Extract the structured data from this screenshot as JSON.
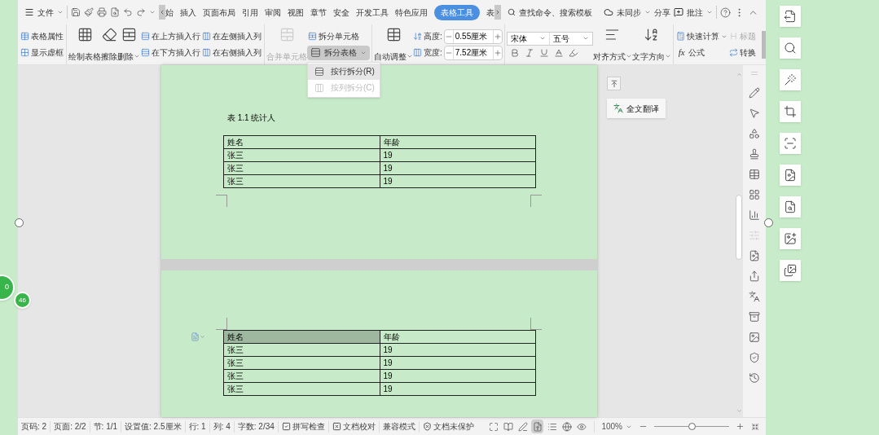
{
  "file_menu": "文件",
  "tabs": [
    {
      "label": "始",
      "selected": false
    },
    {
      "label": "插入",
      "selected": false
    },
    {
      "label": "页面布局",
      "selected": false
    },
    {
      "label": "引用",
      "selected": false
    },
    {
      "label": "审阅",
      "selected": false
    },
    {
      "label": "视图",
      "selected": false
    },
    {
      "label": "章节",
      "selected": false
    },
    {
      "label": "安全",
      "selected": false
    },
    {
      "label": "开发工具",
      "selected": false
    },
    {
      "label": "特色应用",
      "selected": false
    },
    {
      "label": "表格工具",
      "selected": true
    },
    {
      "label": "表",
      "selected": false
    }
  ],
  "search": {
    "placeholder": "查找命令、搜索模板"
  },
  "sync": "未同步",
  "share": "分享",
  "comment": "批注",
  "ribbon": {
    "table_props": [
      "表格属性",
      "显示虚框"
    ],
    "draw_table": "绘制表格",
    "erase": "擦除",
    "delete": "删除",
    "insert": [
      "在上方插入行",
      "在下方插入行",
      "在左侧插入列",
      "在右侧插入列"
    ],
    "merge": {
      "label": "合并单元格",
      "disabled": true
    },
    "split_cells": "拆分单元格",
    "split_table": {
      "label": "拆分表格",
      "expanded": true
    },
    "autofit": "自动调整",
    "height": {
      "label": "高度:",
      "value": "0.55厘米"
    },
    "width": {
      "label": "宽度:",
      "value": "7.52厘米"
    },
    "font": "宋体",
    "font_size": "五号",
    "align": "对齐方式",
    "text_direction": "文字方向",
    "quick_calc": "快速计算",
    "formula": {
      "symbol": "fx",
      "label": "公式"
    },
    "header_row": {
      "label": "标题",
      "disabled": true
    },
    "convert": "转换"
  },
  "split_menu": [
    {
      "label": "按行拆分(R)",
      "selected": true,
      "disabled": false
    },
    {
      "label": "按列拆分(C)",
      "selected": false,
      "disabled": true
    }
  ],
  "translate_button": "全文翻译",
  "pages": [
    {
      "caption": "表 1.1 统计人",
      "header": [
        {
          "text": "姓名",
          "selected": false
        },
        {
          "text": "年龄",
          "selected": false
        }
      ],
      "rows": [
        [
          "张三",
          "19"
        ],
        [
          "张三",
          "19"
        ],
        [
          "张三",
          "19"
        ]
      ]
    },
    {
      "header": [
        {
          "text": "姓名",
          "selected": true
        },
        {
          "text": "年龄",
          "selected": false
        }
      ],
      "rows": [
        [
          "张三",
          "19"
        ],
        [
          "张三",
          "19"
        ],
        [
          "张三",
          "19"
        ],
        [
          "张三",
          "19"
        ]
      ]
    }
  ],
  "status_bar": [
    {
      "text": "页码: 2"
    },
    {
      "text": "页面: 2/2"
    },
    {
      "text": "节: 1/1"
    },
    {
      "text": "设置值: 2.5厘米"
    },
    {
      "text": "行: 1"
    },
    {
      "text": "列: 4"
    },
    {
      "text": "字数: 2/34"
    },
    {
      "text": "拼写检查",
      "kind": "spell"
    },
    {
      "text": "文档校对",
      "kind": "proof"
    },
    {
      "text": "兼容模式"
    },
    {
      "text": "文档未保护",
      "kind": "shield"
    }
  ],
  "view_modes": [
    {
      "kind": "fullscreen",
      "selected": false
    },
    {
      "kind": "reading",
      "selected": false
    },
    {
      "kind": "writing",
      "selected": false
    },
    {
      "kind": "page",
      "selected": true
    },
    {
      "kind": "outline",
      "selected": false
    },
    {
      "kind": "web",
      "selected": false
    },
    {
      "kind": "eye",
      "selected": false
    }
  ],
  "zoom": {
    "text": "100%",
    "level": 0.5
  },
  "badges": [
    "0",
    "46"
  ]
}
